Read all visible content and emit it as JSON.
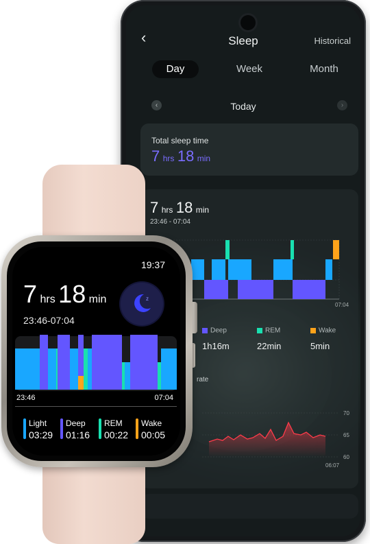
{
  "phone": {
    "back_icon": "chevron-left-icon",
    "title": "Sleep",
    "historical": "Historical",
    "tabs": [
      {
        "label": "Day",
        "active": true
      },
      {
        "label": "Week",
        "active": false
      },
      {
        "label": "Month",
        "active": false
      }
    ],
    "date_label": "Today",
    "total_sleep": {
      "label": "Total sleep time",
      "hours": "7",
      "hours_unit": "hrs",
      "minutes": "18",
      "minutes_unit": "min"
    },
    "detail": {
      "hours": "7",
      "hours_unit": "hrs",
      "minutes": "18",
      "minutes_unit": "min",
      "range": "23:46 - 07:04",
      "end_time": "07:04"
    },
    "stages": [
      {
        "name": "Deep",
        "value": "1h16m",
        "color": "#6356ff"
      },
      {
        "name": "REM",
        "value": "22min",
        "color": "#19e0b0"
      },
      {
        "name": "Wake",
        "value": "5min",
        "color": "#ffa31a"
      }
    ],
    "heart_rate": {
      "label": "rate",
      "ticks": [
        "70",
        "65",
        "60"
      ],
      "end_time": "06:07"
    }
  },
  "watch": {
    "time": "19:37",
    "hours": "7",
    "hours_unit": "hrs",
    "minutes": "18",
    "minutes_unit": "min",
    "range": "23:46-07:04",
    "moon_icon": "moon-sleep-icon",
    "moon_badge": "z",
    "start_time": "23:46",
    "end_time": "07:04",
    "stats": [
      {
        "name": "Light",
        "value": "03:29",
        "color": "#19a7ff"
      },
      {
        "name": "Deep",
        "value": "01:16",
        "color": "#6356ff"
      },
      {
        "name": "REM",
        "value": "00:22",
        "color": "#19e0b0"
      },
      {
        "name": "Wake",
        "value": "00:05",
        "color": "#ffa31a"
      }
    ]
  },
  "colors": {
    "light": "#19a7ff",
    "deep": "#6356ff",
    "rem": "#19e0b0",
    "wake": "#ffa31a",
    "accent_purple": "#7a6dff",
    "heart_line": "#ff3b4a"
  }
}
